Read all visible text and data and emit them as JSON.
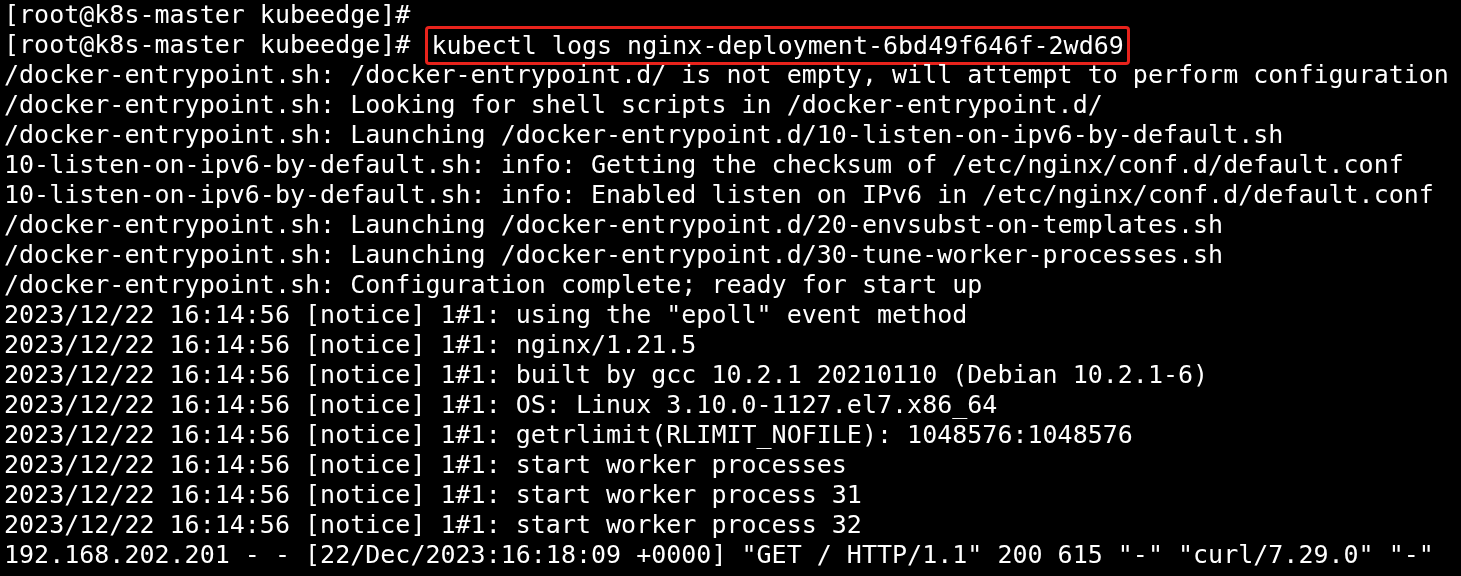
{
  "terminal": {
    "lines": [
      {
        "kind": "prompt",
        "prompt": "[root@k8s-master kubeedge]#"
      },
      {
        "kind": "prompt",
        "prompt": "[root@k8s-master kubeedge]#",
        "command": "kubectl logs nginx-deployment-6bd49f646f-2wd69",
        "highlighted": true
      },
      {
        "kind": "output",
        "text": "/docker-entrypoint.sh: /docker-entrypoint.d/ is not empty, will attempt to perform configuration"
      },
      {
        "kind": "output",
        "text": "/docker-entrypoint.sh: Looking for shell scripts in /docker-entrypoint.d/"
      },
      {
        "kind": "output",
        "text": "/docker-entrypoint.sh: Launching /docker-entrypoint.d/10-listen-on-ipv6-by-default.sh"
      },
      {
        "kind": "output",
        "text": "10-listen-on-ipv6-by-default.sh: info: Getting the checksum of /etc/nginx/conf.d/default.conf"
      },
      {
        "kind": "output",
        "text": "10-listen-on-ipv6-by-default.sh: info: Enabled listen on IPv6 in /etc/nginx/conf.d/default.conf"
      },
      {
        "kind": "output",
        "text": "/docker-entrypoint.sh: Launching /docker-entrypoint.d/20-envsubst-on-templates.sh"
      },
      {
        "kind": "output",
        "text": "/docker-entrypoint.sh: Launching /docker-entrypoint.d/30-tune-worker-processes.sh"
      },
      {
        "kind": "output",
        "text": "/docker-entrypoint.sh: Configuration complete; ready for start up"
      },
      {
        "kind": "output",
        "text": "2023/12/22 16:14:56 [notice] 1#1: using the \"epoll\" event method"
      },
      {
        "kind": "output",
        "text": "2023/12/22 16:14:56 [notice] 1#1: nginx/1.21.5"
      },
      {
        "kind": "output",
        "text": "2023/12/22 16:14:56 [notice] 1#1: built by gcc 10.2.1 20210110 (Debian 10.2.1-6)"
      },
      {
        "kind": "output",
        "text": "2023/12/22 16:14:56 [notice] 1#1: OS: Linux 3.10.0-1127.el7.x86_64"
      },
      {
        "kind": "output",
        "text": "2023/12/22 16:14:56 [notice] 1#1: getrlimit(RLIMIT_NOFILE): 1048576:1048576"
      },
      {
        "kind": "output",
        "text": "2023/12/22 16:14:56 [notice] 1#1: start worker processes"
      },
      {
        "kind": "output",
        "text": "2023/12/22 16:14:56 [notice] 1#1: start worker process 31"
      },
      {
        "kind": "output",
        "text": "2023/12/22 16:14:56 [notice] 1#1: start worker process 32"
      },
      {
        "kind": "output",
        "text": "192.168.202.201 - - [22/Dec/2023:16:18:09 +0000] \"GET / HTTP/1.1\" 200 615 \"-\" \"curl/7.29.0\" \"-\""
      }
    ]
  }
}
